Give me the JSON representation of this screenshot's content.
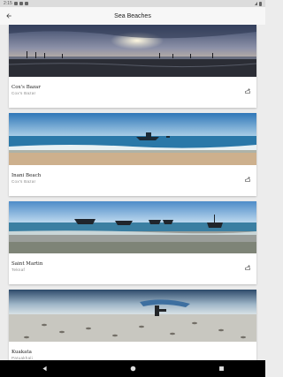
{
  "status_bar": {
    "time": "2:15"
  },
  "app_bar": {
    "title": "Sea Beaches"
  },
  "beaches": [
    {
      "name": "Cox's Bazar",
      "location": "Cox's Bazar"
    },
    {
      "name": "Inani Beach",
      "location": "Cox's Bazar"
    },
    {
      "name": "Saint Martin",
      "location": "Teknaf"
    },
    {
      "name": "Kuakata",
      "location": "Patuakhali"
    }
  ],
  "icons": {
    "back": "arrow-back-icon",
    "share": "share-icon",
    "nav_back": "triangle-back-icon",
    "nav_home": "circle-home-icon",
    "nav_recents": "square-recents-icon"
  },
  "colors": {
    "app_bar_bg": "#f7f7f7",
    "list_bg": "#ececec",
    "card_bg": "#ffffff"
  }
}
